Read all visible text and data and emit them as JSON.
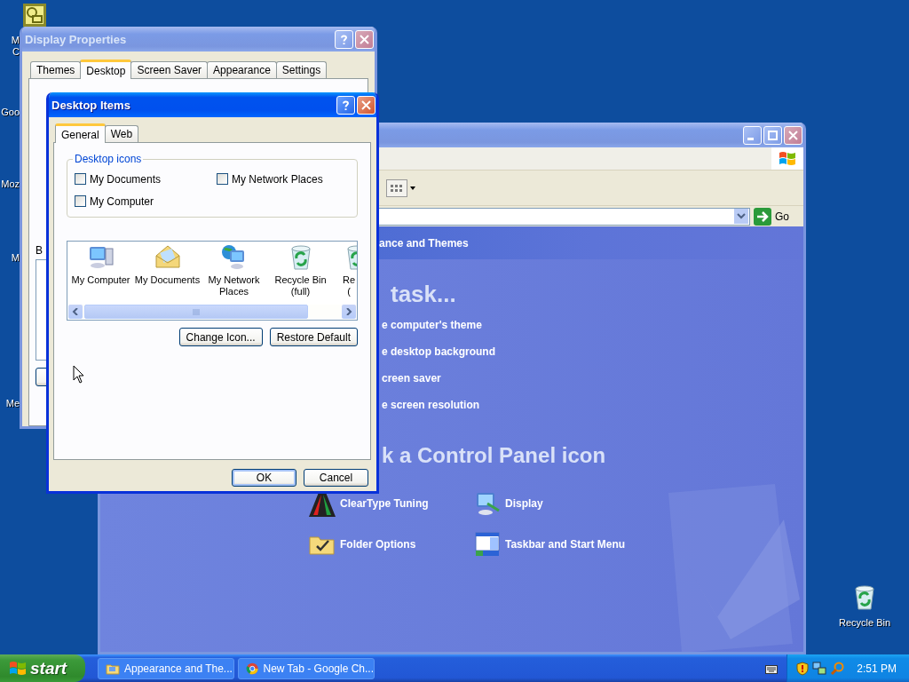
{
  "desktop_icons": [
    {
      "lines": [
        "M",
        "C"
      ]
    },
    {
      "lines": [
        "Goo"
      ]
    },
    {
      "lines": [
        "Moz"
      ]
    },
    {
      "lines": [
        "M"
      ]
    },
    {
      "lines": [
        "Me"
      ]
    }
  ],
  "recycle_bin": {
    "label": "Recycle Bin"
  },
  "display_properties": {
    "title": "Display Properties",
    "tabs": [
      {
        "label": "Themes",
        "selected": false
      },
      {
        "label": "Desktop",
        "selected": true
      },
      {
        "label": "Screen Saver",
        "selected": false
      },
      {
        "label": "Appearance",
        "selected": false
      },
      {
        "label": "Settings",
        "selected": false
      }
    ],
    "field_label": "B"
  },
  "desktop_items": {
    "title": "Desktop Items",
    "tabs": [
      {
        "label": "General",
        "selected": true
      },
      {
        "label": "Web",
        "selected": false
      }
    ],
    "group_title": "Desktop icons",
    "checkboxes": [
      {
        "label": "My Documents",
        "checked": false
      },
      {
        "label": "My Network Places",
        "checked": false
      },
      {
        "label": "My Computer",
        "checked": false
      }
    ],
    "icons": [
      {
        "lines": [
          "My Computer"
        ],
        "kind": "computer",
        "selected": false
      },
      {
        "lines": [
          "My Documents"
        ],
        "kind": "documents",
        "selected": false
      },
      {
        "lines": [
          "My Network",
          "Places"
        ],
        "kind": "network",
        "selected": false
      },
      {
        "lines": [
          "Recycle Bin",
          "(full)"
        ],
        "kind": "recycle",
        "selected": false
      },
      {
        "lines": [
          "Re",
          "("
        ],
        "kind": "recycle",
        "selected": false
      }
    ],
    "buttons": [
      "Change Icon...",
      "Restore Default"
    ],
    "footer_buttons": [
      "OK",
      "Cancel"
    ]
  },
  "control_panel": {
    "go_label": "Go",
    "category": "ance and Themes",
    "task_heading": "task...",
    "tasks": [
      "e computer's theme",
      "e desktop background",
      "creen saver",
      "e screen resolution"
    ],
    "icon_heading": "k a Control Panel icon",
    "items": [
      {
        "label": "ClearType Tuning",
        "kind": "cleartype"
      },
      {
        "label": "Display",
        "kind": "display"
      },
      {
        "label": "Folder Options",
        "kind": "folder"
      },
      {
        "label": "Taskbar and Start Menu",
        "kind": "taskbar"
      }
    ]
  },
  "taskbar": {
    "start": "start",
    "tasks": [
      {
        "label": "Appearance and The...",
        "kind": "folder",
        "selected": false
      },
      {
        "label": "New Tab - Google Ch...",
        "kind": "browser",
        "selected": false
      }
    ],
    "clock": "2:51 PM"
  }
}
